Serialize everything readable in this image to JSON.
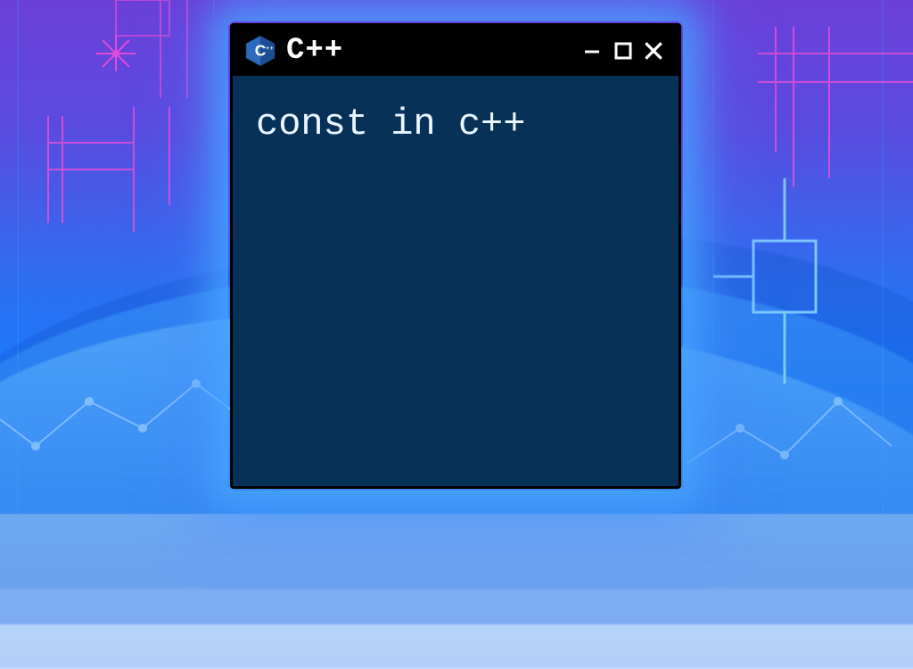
{
  "window": {
    "title": "C++",
    "content_text": "const in c++"
  },
  "colors": {
    "titlebar": "#000000",
    "content_bg": "#083157",
    "text": "#eaf6ff",
    "glow": "#4aa8ff"
  }
}
